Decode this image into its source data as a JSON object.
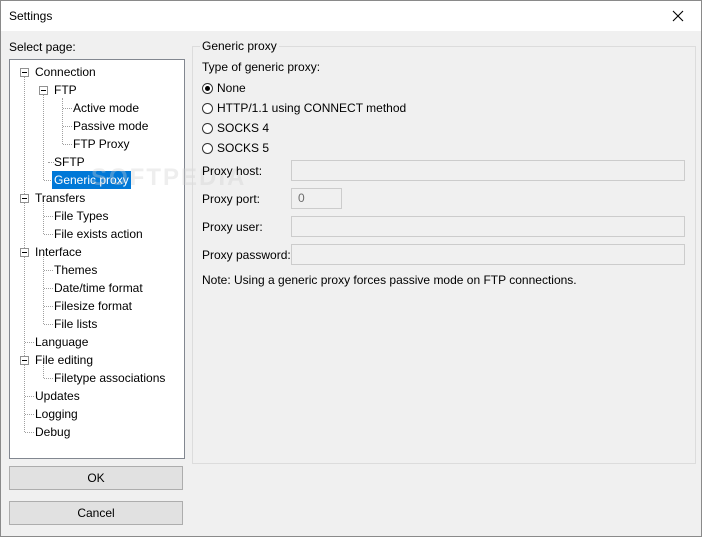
{
  "window": {
    "title": "Settings"
  },
  "tree": {
    "label": "Select page:",
    "items": [
      {
        "label": "Connection"
      },
      {
        "label": "FTP"
      },
      {
        "label": "Active mode"
      },
      {
        "label": "Passive mode"
      },
      {
        "label": "FTP Proxy"
      },
      {
        "label": "SFTP"
      },
      {
        "label": "Generic proxy",
        "selected": true
      },
      {
        "label": "Transfers"
      },
      {
        "label": "File Types"
      },
      {
        "label": "File exists action"
      },
      {
        "label": "Interface"
      },
      {
        "label": "Themes"
      },
      {
        "label": "Date/time format"
      },
      {
        "label": "Filesize format"
      },
      {
        "label": "File lists"
      },
      {
        "label": "Language"
      },
      {
        "label": "File editing"
      },
      {
        "label": "Filetype associations"
      },
      {
        "label": "Updates"
      },
      {
        "label": "Logging"
      },
      {
        "label": "Debug"
      }
    ]
  },
  "buttons": {
    "ok": "OK",
    "cancel": "Cancel"
  },
  "panel": {
    "group_title": "Generic proxy",
    "type_label": "Type of generic proxy:",
    "options": [
      {
        "label": "None",
        "checked": true
      },
      {
        "label": "HTTP/1.1 using CONNECT method",
        "checked": false
      },
      {
        "label": "SOCKS 4",
        "checked": false
      },
      {
        "label": "SOCKS 5",
        "checked": false
      }
    ],
    "host_label": "Proxy host:",
    "host_value": "",
    "port_label": "Proxy port:",
    "port_value": "0",
    "user_label": "Proxy user:",
    "user_value": "",
    "password_label": "Proxy password:",
    "password_value": "",
    "note": "Note: Using a generic proxy forces passive mode on FTP connections."
  },
  "watermark": "SOFTPEDIA"
}
